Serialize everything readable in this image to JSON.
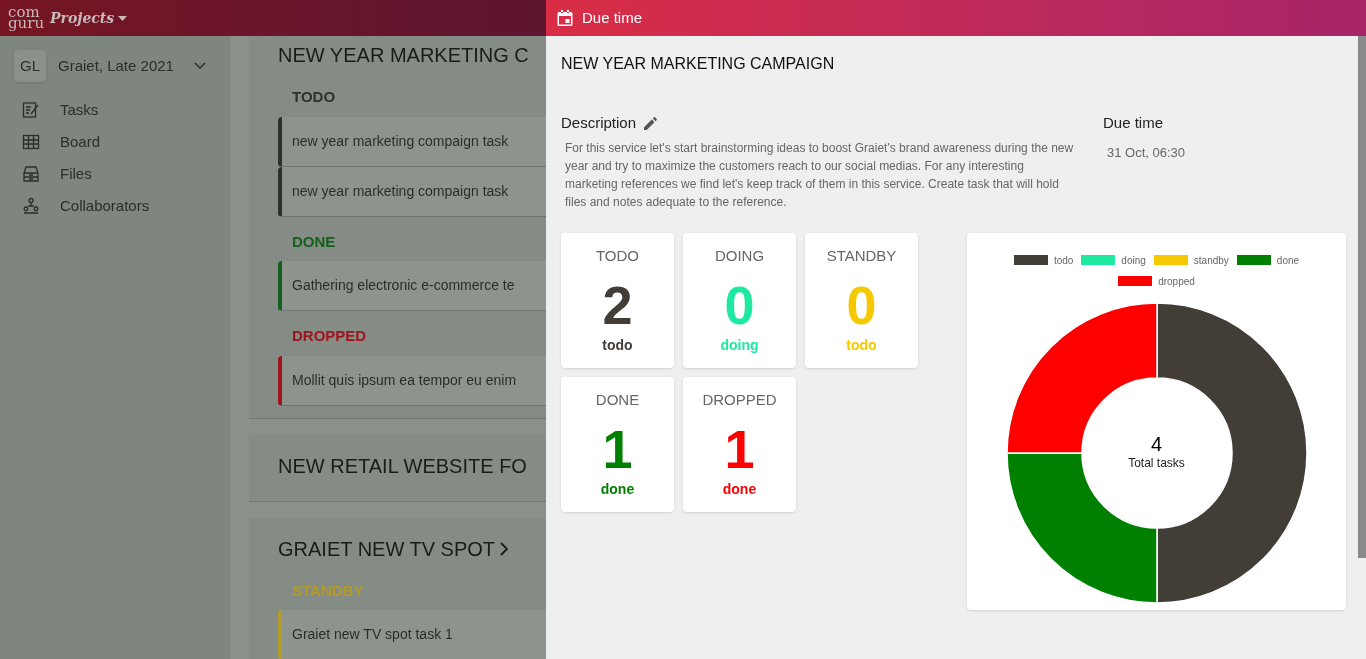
{
  "app_bar": {
    "logo_top": "com",
    "logo_bottom": "guru",
    "product": "Projects"
  },
  "sidebar": {
    "workspace": {
      "initials": "GL",
      "name": "Graiet, Late 2021"
    },
    "items": [
      {
        "label": "Tasks",
        "kind": "tasks"
      },
      {
        "label": "Board",
        "kind": "board"
      },
      {
        "label": "Files",
        "kind": "files"
      },
      {
        "label": "Collaborators",
        "kind": "collaborators"
      }
    ]
  },
  "projects": [
    {
      "title": "NEW YEAR MARKETING C",
      "expanded": true,
      "groups": [
        {
          "status": "TODO",
          "color": "#2e322f",
          "tasks": [
            "new year marketing compaign task",
            "new year marketing compaign task"
          ]
        },
        {
          "status": "DONE",
          "color": "#15601a",
          "tasks": [
            "Gathering electronic e-commerce te"
          ]
        },
        {
          "status": "DROPPED",
          "color": "#a0141c",
          "tasks": [
            "Mollit quis ipsum ea tempor eu enim"
          ]
        }
      ]
    },
    {
      "title": "NEW RETAIL WEBSITE FO",
      "expanded": false
    },
    {
      "title": "GRAIET NEW TV SPOT",
      "expanded": true,
      "groups": [
        {
          "status": "STANDBY",
          "color": "#b49a28",
          "tasks": [
            "Graiet new TV spot task 1"
          ]
        }
      ]
    }
  ],
  "drawer": {
    "header": "Due time",
    "title": "NEW YEAR MARKETING CAMPAIGN",
    "description_label": "Description",
    "description": "For this service let's start brainstorming ideas to boost Graiet's brand awareness during the new year and try to maximize the customers reach to our social medias. For any interesting marketing references we find let's keep track of them in this service. Create task that will hold files and notes adequate to the reference.",
    "due_label": "Due time",
    "due_value": "31 Oct, 06:30",
    "stats": [
      {
        "title": "TODO",
        "count": "2",
        "caption": "todo",
        "color": "#433d38"
      },
      {
        "title": "DOING",
        "count": "0",
        "caption": "doing",
        "color": "#1de9a0"
      },
      {
        "title": "STANDBY",
        "count": "0",
        "caption": "todo",
        "color": "#f5c800"
      },
      {
        "title": "DONE",
        "count": "1",
        "caption": "done",
        "color": "#008000"
      },
      {
        "title": "DROPPED",
        "count": "1",
        "caption": "done",
        "color": "#ff0000"
      }
    ],
    "chart": {
      "center_value": "4",
      "center_label": "Total tasks",
      "legend": [
        {
          "color": "#433d38"
        },
        {
          "color": "#1de9a0"
        },
        {
          "color": "#f5c800"
        },
        {
          "color": "#008000"
        },
        {
          "color": "#ff0000"
        }
      ],
      "chart_data": {
        "type": "donut",
        "categories": [
          "todo",
          "doing",
          "standby",
          "done",
          "dropped"
        ],
        "values": [
          50,
          0,
          0,
          25,
          25
        ]
      }
    }
  }
}
